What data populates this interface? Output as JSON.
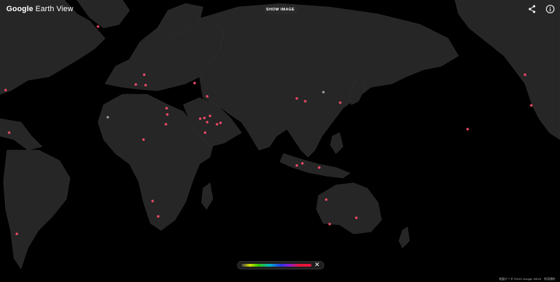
{
  "header": {
    "logo_google": "Google",
    "logo_product": "Earth View",
    "show_image_label": "SHOW IMAGE",
    "share_icon": "share-icon",
    "info_icon": "info-icon"
  },
  "map": {
    "background_color": "#000000",
    "land_color": "#262626",
    "marker_color": "#f04a68"
  },
  "legend": {
    "close_label": "✕",
    "gradient_colors": [
      "#444444",
      "#d9e000",
      "#35c400",
      "#00b7c7",
      "#2a37e6",
      "#8a1ed6",
      "#e8153d"
    ]
  },
  "footer": {
    "copyright": "地図データ ©2021 Google, INEGI　利用規約"
  }
}
